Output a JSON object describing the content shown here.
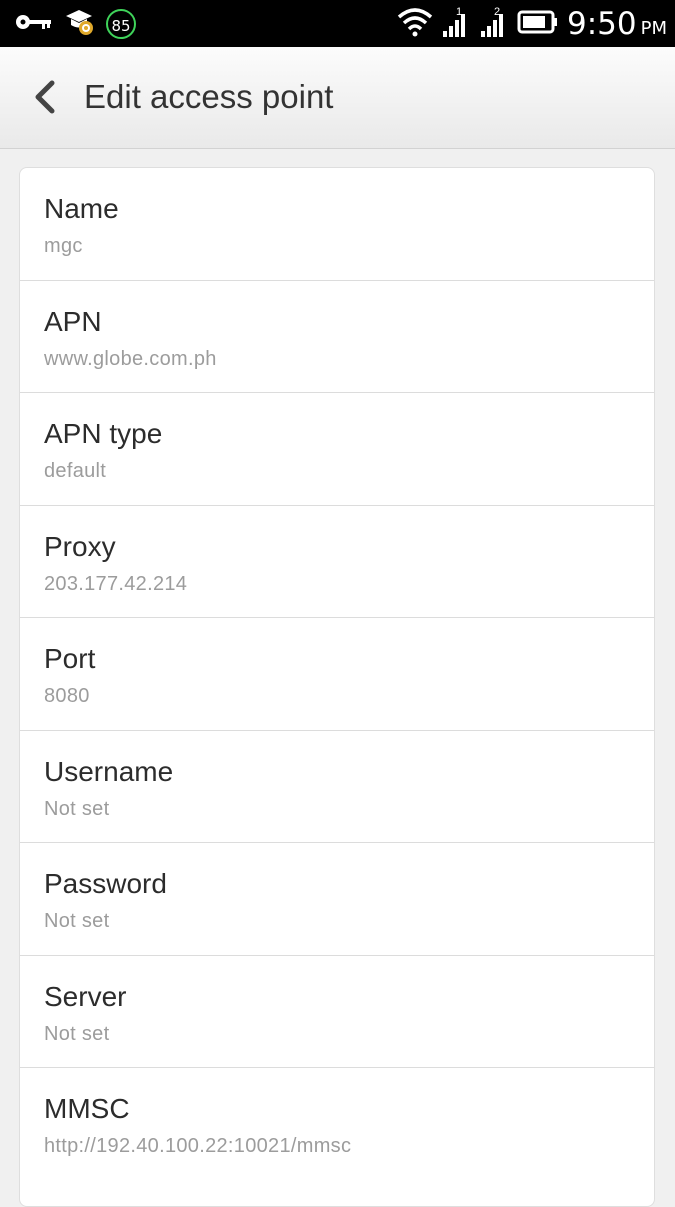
{
  "status_bar": {
    "signal_1_label": "1",
    "signal_2_label": "2",
    "notification_badge": "85",
    "time": "9:50",
    "ampm": "PM"
  },
  "header": {
    "title": "Edit access point"
  },
  "settings": [
    {
      "label": "Name",
      "value": "mgc"
    },
    {
      "label": "APN",
      "value": "www.globe.com.ph"
    },
    {
      "label": "APN type",
      "value": "default"
    },
    {
      "label": "Proxy",
      "value": "203.177.42.214"
    },
    {
      "label": "Port",
      "value": "8080"
    },
    {
      "label": "Username",
      "value": "Not set"
    },
    {
      "label": "Password",
      "value": "Not set"
    },
    {
      "label": "Server",
      "value": "Not set"
    },
    {
      "label": "MMSC",
      "value": "http://192.40.100.22:10021/mmsc"
    }
  ],
  "colors": {
    "status_bar_bg": "#000000",
    "badge_ring": "#3fd35a",
    "page_bg": "#f0f0f0",
    "card_bg": "#ffffff",
    "label_text": "#2c2c2c",
    "value_text": "#9c9c9c"
  },
  "icons": {
    "status_left": [
      "key-icon",
      "graduation-cap-badge-icon",
      "notification-count-icon"
    ],
    "status_right": [
      "wifi-icon",
      "signal-sim1-icon",
      "signal-sim2-icon",
      "battery-icon"
    ],
    "header": "back-chevron-icon"
  }
}
